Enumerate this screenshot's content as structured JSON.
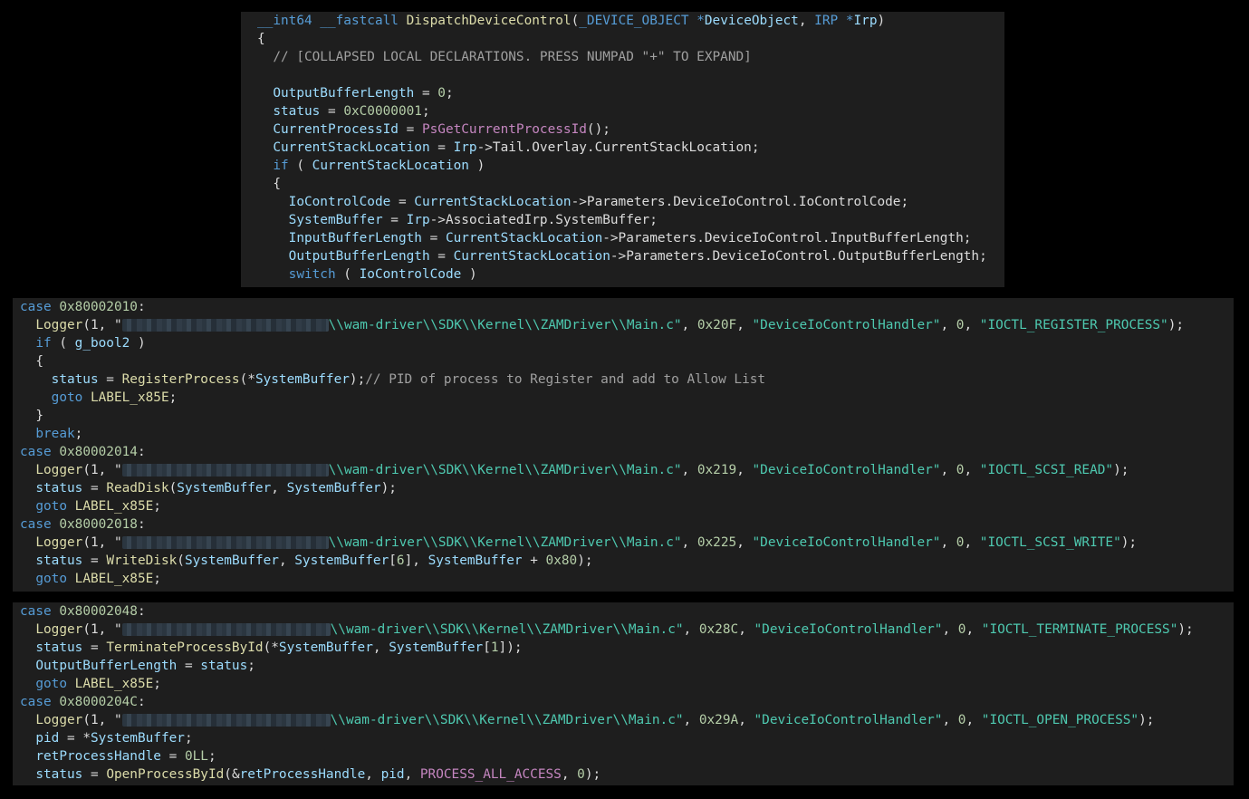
{
  "colors": {
    "background": "#000000",
    "panel": "#1e1e1e",
    "keyword": "#569cd6",
    "variable": "#9cdcfe",
    "number": "#b5cea8",
    "string": "#4ec9b0",
    "function": "#dcdcaa",
    "comment": "#a0a0a0",
    "macro": "#c586c0",
    "text": "#dcdcdc"
  },
  "panels": [
    {
      "name": "function-header-panel",
      "lines": [
        [
          [
            "k",
            "__int64 __fastcall "
          ],
          [
            "f",
            "DispatchDeviceControl"
          ],
          [
            "p",
            "("
          ],
          [
            "k",
            "_DEVICE_OBJECT *"
          ],
          [
            "v",
            "DeviceObject"
          ],
          [
            "p",
            ", "
          ],
          [
            "k",
            "IRP *"
          ],
          [
            "v",
            "Irp"
          ],
          [
            "p",
            ")"
          ]
        ],
        [
          [
            "p",
            "{"
          ]
        ],
        [
          [
            "c",
            "  // [COLLAPSED LOCAL DECLARATIONS. PRESS NUMPAD \"+\" TO EXPAND]"
          ]
        ],
        [],
        [
          [
            "p",
            "  "
          ],
          [
            "v",
            "OutputBufferLength"
          ],
          [
            "p",
            " = "
          ],
          [
            "n",
            "0"
          ],
          [
            "p",
            ";"
          ]
        ],
        [
          [
            "p",
            "  "
          ],
          [
            "v",
            "status"
          ],
          [
            "p",
            " = "
          ],
          [
            "n",
            "0xC0000001"
          ],
          [
            "p",
            ";"
          ]
        ],
        [
          [
            "p",
            "  "
          ],
          [
            "v",
            "CurrentProcessId"
          ],
          [
            "p",
            " = "
          ],
          [
            "m",
            "PsGetCurrentProcessId"
          ],
          [
            "p",
            "();"
          ]
        ],
        [
          [
            "p",
            "  "
          ],
          [
            "v",
            "CurrentStackLocation"
          ],
          [
            "p",
            " = "
          ],
          [
            "v",
            "Irp"
          ],
          [
            "p",
            "->Tail.Overlay.CurrentStackLocation;"
          ]
        ],
        [
          [
            "p",
            "  "
          ],
          [
            "k",
            "if"
          ],
          [
            "p",
            " ( "
          ],
          [
            "v",
            "CurrentStackLocation"
          ],
          [
            "p",
            " )"
          ]
        ],
        [
          [
            "p",
            "  {"
          ]
        ],
        [
          [
            "p",
            "    "
          ],
          [
            "v",
            "IoControlCode"
          ],
          [
            "p",
            " = "
          ],
          [
            "v",
            "CurrentStackLocation"
          ],
          [
            "p",
            "->Parameters.DeviceIoControl.IoControlCode;"
          ]
        ],
        [
          [
            "p",
            "    "
          ],
          [
            "v",
            "SystemBuffer"
          ],
          [
            "p",
            " = "
          ],
          [
            "v",
            "Irp"
          ],
          [
            "p",
            "->AssociatedIrp.SystemBuffer;"
          ]
        ],
        [
          [
            "p",
            "    "
          ],
          [
            "v",
            "InputBufferLength"
          ],
          [
            "p",
            " = "
          ],
          [
            "v",
            "CurrentStackLocation"
          ],
          [
            "p",
            "->Parameters.DeviceIoControl.InputBufferLength;"
          ]
        ],
        [
          [
            "p",
            "    "
          ],
          [
            "v",
            "OutputBufferLength"
          ],
          [
            "p",
            " = "
          ],
          [
            "v",
            "CurrentStackLocation"
          ],
          [
            "p",
            "->Parameters.DeviceIoControl.OutputBufferLength;"
          ]
        ],
        [
          [
            "p",
            "    "
          ],
          [
            "k",
            "switch"
          ],
          [
            "p",
            " ( "
          ],
          [
            "v",
            "IoControlCode"
          ],
          [
            "p",
            " )"
          ]
        ]
      ]
    },
    {
      "name": "register-read-write-panel",
      "lines": [
        [
          [
            "k",
            "case "
          ],
          [
            "n",
            "0x80002010"
          ],
          [
            "p",
            ":"
          ]
        ],
        [
          [
            "p",
            "  "
          ],
          [
            "f",
            "Logger"
          ],
          [
            "p",
            "(1, \""
          ],
          [
            "r",
            "228"
          ],
          [
            "s",
            "\\\\wam-driver\\\\SDK\\\\Kernel\\\\ZAMDriver\\\\Main.c"
          ],
          [
            "s",
            "\""
          ],
          [
            "p",
            ", "
          ],
          [
            "n",
            "0x20F"
          ],
          [
            "p",
            ", "
          ],
          [
            "s",
            "\"DeviceIoControlHandler\""
          ],
          [
            "p",
            ", "
          ],
          [
            "n",
            "0"
          ],
          [
            "p",
            ", "
          ],
          [
            "s",
            "\"IOCTL_REGISTER_PROCESS\""
          ],
          [
            "p",
            ");"
          ]
        ],
        [
          [
            "p",
            "  "
          ],
          [
            "k",
            "if"
          ],
          [
            "p",
            " ( "
          ],
          [
            "v",
            "g_bool2"
          ],
          [
            "p",
            " )"
          ]
        ],
        [
          [
            "p",
            "  {"
          ]
        ],
        [
          [
            "p",
            "    "
          ],
          [
            "v",
            "status"
          ],
          [
            "p",
            " = "
          ],
          [
            "f",
            "RegisterProcess"
          ],
          [
            "p",
            "(*"
          ],
          [
            "v",
            "SystemBuffer"
          ],
          [
            "p",
            ");"
          ],
          [
            "c",
            "// PID of process to Register and add to Allow List"
          ]
        ],
        [
          [
            "p",
            "    "
          ],
          [
            "k",
            "goto "
          ],
          [
            "f",
            "LABEL_x85E"
          ],
          [
            "p",
            ";"
          ]
        ],
        [
          [
            "p",
            "  }"
          ]
        ],
        [
          [
            "p",
            "  "
          ],
          [
            "k",
            "break"
          ],
          [
            "p",
            ";"
          ]
        ],
        [
          [
            "k",
            "case "
          ],
          [
            "n",
            "0x80002014"
          ],
          [
            "p",
            ":"
          ]
        ],
        [
          [
            "p",
            "  "
          ],
          [
            "f",
            "Logger"
          ],
          [
            "p",
            "(1, \""
          ],
          [
            "r",
            "228"
          ],
          [
            "s",
            "\\\\wam-driver\\\\SDK\\\\Kernel\\\\ZAMDriver\\\\Main.c"
          ],
          [
            "s",
            "\""
          ],
          [
            "p",
            ", "
          ],
          [
            "n",
            "0x219"
          ],
          [
            "p",
            ", "
          ],
          [
            "s",
            "\"DeviceIoControlHandler\""
          ],
          [
            "p",
            ", "
          ],
          [
            "n",
            "0"
          ],
          [
            "p",
            ", "
          ],
          [
            "s",
            "\"IOCTL_SCSI_READ\""
          ],
          [
            "p",
            ");"
          ]
        ],
        [
          [
            "p",
            "  "
          ],
          [
            "v",
            "status"
          ],
          [
            "p",
            " = "
          ],
          [
            "f",
            "ReadDisk"
          ],
          [
            "p",
            "("
          ],
          [
            "v",
            "SystemBuffer"
          ],
          [
            "p",
            ", "
          ],
          [
            "v",
            "SystemBuffer"
          ],
          [
            "p",
            ");"
          ]
        ],
        [
          [
            "p",
            "  "
          ],
          [
            "k",
            "goto "
          ],
          [
            "f",
            "LABEL_x85E"
          ],
          [
            "p",
            ";"
          ]
        ],
        [
          [
            "k",
            "case "
          ],
          [
            "n",
            "0x80002018"
          ],
          [
            "p",
            ":"
          ]
        ],
        [
          [
            "p",
            "  "
          ],
          [
            "f",
            "Logger"
          ],
          [
            "p",
            "(1, \""
          ],
          [
            "r",
            "228"
          ],
          [
            "s",
            "\\\\wam-driver\\\\SDK\\\\Kernel\\\\ZAMDriver\\\\Main.c"
          ],
          [
            "s",
            "\""
          ],
          [
            "p",
            ", "
          ],
          [
            "n",
            "0x225"
          ],
          [
            "p",
            ", "
          ],
          [
            "s",
            "\"DeviceIoControlHandler\""
          ],
          [
            "p",
            ", "
          ],
          [
            "n",
            "0"
          ],
          [
            "p",
            ", "
          ],
          [
            "s",
            "\"IOCTL_SCSI_WRITE\""
          ],
          [
            "p",
            ");"
          ]
        ],
        [
          [
            "p",
            "  "
          ],
          [
            "v",
            "status"
          ],
          [
            "p",
            " = "
          ],
          [
            "f",
            "WriteDisk"
          ],
          [
            "p",
            "("
          ],
          [
            "v",
            "SystemBuffer"
          ],
          [
            "p",
            ", "
          ],
          [
            "v",
            "SystemBuffer"
          ],
          [
            "p",
            "["
          ],
          [
            "n",
            "6"
          ],
          [
            "p",
            "], "
          ],
          [
            "v",
            "SystemBuffer"
          ],
          [
            "p",
            " + "
          ],
          [
            "n",
            "0x80"
          ],
          [
            "p",
            ");"
          ]
        ],
        [
          [
            "p",
            "  "
          ],
          [
            "k",
            "goto "
          ],
          [
            "f",
            "LABEL_x85E"
          ],
          [
            "p",
            ";"
          ]
        ]
      ]
    },
    {
      "name": "terminate-open-panel",
      "lines": [
        [
          [
            "k",
            "case "
          ],
          [
            "n",
            "0x80002048"
          ],
          [
            "p",
            ":"
          ]
        ],
        [
          [
            "p",
            "  "
          ],
          [
            "f",
            "Logger"
          ],
          [
            "p",
            "(1, \""
          ],
          [
            "r",
            "230"
          ],
          [
            "s",
            "\\\\wam-driver\\\\SDK\\\\Kernel\\\\ZAMDriver\\\\Main.c"
          ],
          [
            "s",
            "\""
          ],
          [
            "p",
            ", "
          ],
          [
            "n",
            "0x28C"
          ],
          [
            "p",
            ", "
          ],
          [
            "s",
            "\"DeviceIoControlHandler\""
          ],
          [
            "p",
            ", "
          ],
          [
            "n",
            "0"
          ],
          [
            "p",
            ", "
          ],
          [
            "s",
            "\"IOCTL_TERMINATE_PROCESS\""
          ],
          [
            "p",
            ");"
          ]
        ],
        [
          [
            "p",
            "  "
          ],
          [
            "v",
            "status"
          ],
          [
            "p",
            " = "
          ],
          [
            "f",
            "TerminateProcessById"
          ],
          [
            "p",
            "(*"
          ],
          [
            "v",
            "SystemBuffer"
          ],
          [
            "p",
            ", "
          ],
          [
            "v",
            "SystemBuffer"
          ],
          [
            "p",
            "["
          ],
          [
            "n",
            "1"
          ],
          [
            "p",
            "]);"
          ]
        ],
        [
          [
            "p",
            "  "
          ],
          [
            "v",
            "OutputBufferLength"
          ],
          [
            "p",
            " = "
          ],
          [
            "v",
            "status"
          ],
          [
            "p",
            ";"
          ]
        ],
        [
          [
            "p",
            "  "
          ],
          [
            "k",
            "goto "
          ],
          [
            "f",
            "LABEL_x85E"
          ],
          [
            "p",
            ";"
          ]
        ],
        [
          [
            "k",
            "case "
          ],
          [
            "n",
            "0x8000204C"
          ],
          [
            "p",
            ":"
          ]
        ],
        [
          [
            "p",
            "  "
          ],
          [
            "f",
            "Logger"
          ],
          [
            "p",
            "(1, \""
          ],
          [
            "r",
            "230"
          ],
          [
            "s",
            "\\\\wam-driver\\\\SDK\\\\Kernel\\\\ZAMDriver\\\\Main.c"
          ],
          [
            "s",
            "\""
          ],
          [
            "p",
            ", "
          ],
          [
            "n",
            "0x29A"
          ],
          [
            "p",
            ", "
          ],
          [
            "s",
            "\"DeviceIoControlHandler\""
          ],
          [
            "p",
            ", "
          ],
          [
            "n",
            "0"
          ],
          [
            "p",
            ", "
          ],
          [
            "s",
            "\"IOCTL_OPEN_PROCESS\""
          ],
          [
            "p",
            ");"
          ]
        ],
        [
          [
            "p",
            "  "
          ],
          [
            "v",
            "pid"
          ],
          [
            "p",
            " = *"
          ],
          [
            "v",
            "SystemBuffer"
          ],
          [
            "p",
            ";"
          ]
        ],
        [
          [
            "p",
            "  "
          ],
          [
            "v",
            "retProcessHandle"
          ],
          [
            "p",
            " = "
          ],
          [
            "n",
            "0LL"
          ],
          [
            "p",
            ";"
          ]
        ],
        [
          [
            "p",
            "  "
          ],
          [
            "v",
            "status"
          ],
          [
            "p",
            " = "
          ],
          [
            "f",
            "OpenProcessById"
          ],
          [
            "p",
            "(&"
          ],
          [
            "v",
            "retProcessHandle"
          ],
          [
            "p",
            ", "
          ],
          [
            "v",
            "pid"
          ],
          [
            "p",
            ", "
          ],
          [
            "m",
            "PROCESS_ALL_ACCESS"
          ],
          [
            "p",
            ", "
          ],
          [
            "n",
            "0"
          ],
          [
            "p",
            ");"
          ]
        ]
      ]
    }
  ]
}
